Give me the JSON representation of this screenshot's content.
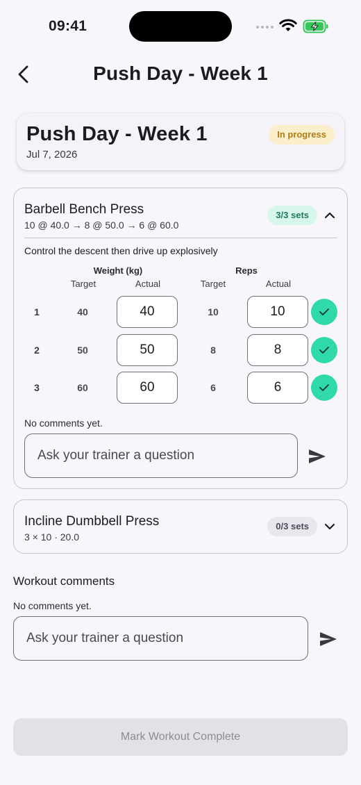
{
  "status_bar": {
    "time": "09:41"
  },
  "app_bar": {
    "title": "Push Day - Week 1"
  },
  "header": {
    "title": "Push Day - Week 1",
    "date": "Jul 7, 2026",
    "status": "In progress",
    "status_color": "#b07d12"
  },
  "exercises": [
    {
      "name": "Barbell Bench Press",
      "summary": "10 @ 40.0  →  8 @ 50.0  →  6 @ 60.0",
      "sets_badge": "3/3 sets",
      "expanded": true,
      "note": "Control the descent then drive up explosively",
      "headers": {
        "weight": "Weight (kg)",
        "reps": "Reps",
        "target": "Target",
        "actual": "Actual"
      },
      "sets": [
        {
          "num": "1",
          "target_weight": "40",
          "actual_weight": "40",
          "target_reps": "10",
          "actual_reps": "10",
          "done": true
        },
        {
          "num": "2",
          "target_weight": "50",
          "actual_weight": "50",
          "target_reps": "8",
          "actual_reps": "8",
          "done": true
        },
        {
          "num": "3",
          "target_weight": "60",
          "actual_weight": "60",
          "target_reps": "6",
          "actual_reps": "6",
          "done": true
        }
      ],
      "comments_empty": "No comments yet.",
      "ask_placeholder": "Ask your trainer a question"
    },
    {
      "name": "Incline Dumbbell Press",
      "summary": "3 × 10 · 20.0",
      "sets_badge": "0/3 sets",
      "expanded": false
    }
  ],
  "workout_comments": {
    "title": "Workout comments",
    "empty": "No comments yet.",
    "ask_placeholder": "Ask your trainer a question"
  },
  "complete_button": {
    "label": "Mark Workout Complete",
    "enabled": false
  },
  "colors": {
    "accent_green": "#2fd9a9",
    "badge_yellow_bg": "#fbeecb",
    "badge_green_bg": "#d7f6ec",
    "background": "#f8f6fb"
  },
  "icons": {
    "back": "arrow-back-icon",
    "collapse": "chevron-up-icon",
    "expand": "chevron-down-icon",
    "check": "check-icon",
    "send": "send-icon"
  }
}
